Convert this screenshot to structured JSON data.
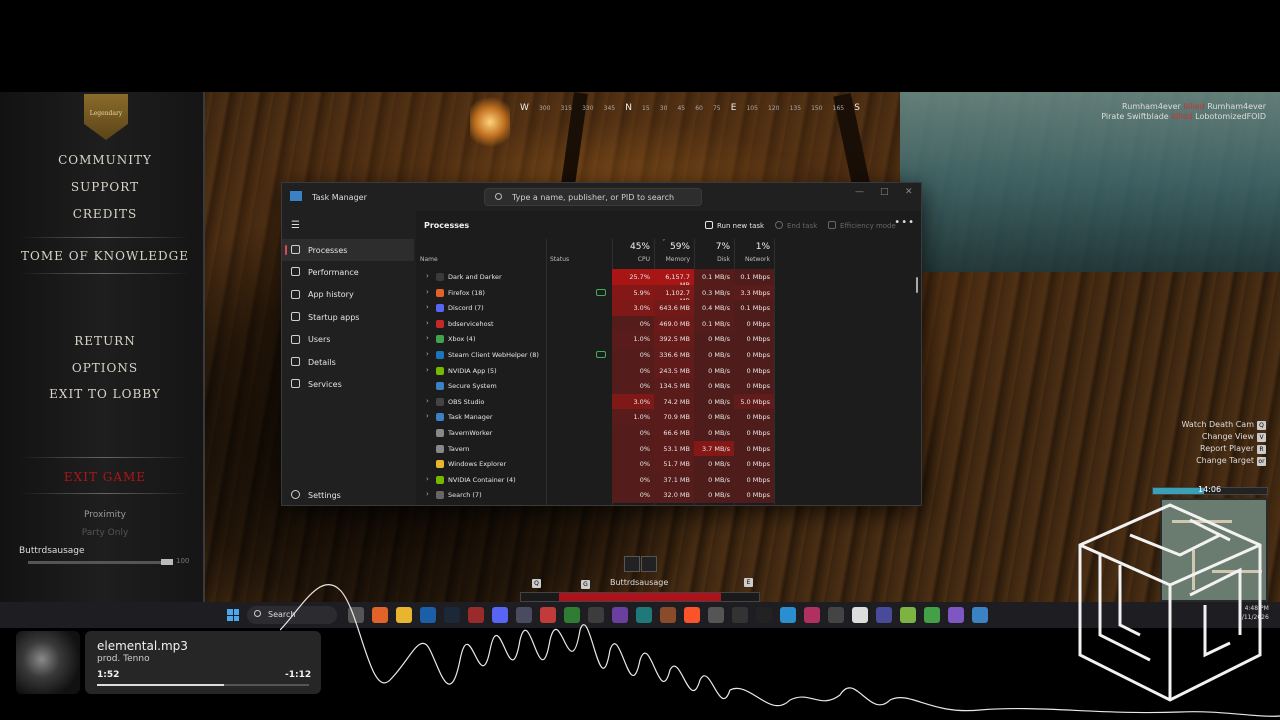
{
  "game": {
    "crest_text": "Legendary",
    "menu": {
      "community": "COMMUNITY",
      "support": "SUPPORT",
      "credits": "CREDITS",
      "tome": "TOME OF KNOWLEDGE",
      "return": "RETURN",
      "options": "OPTIONS",
      "exit_lobby": "EXIT TO LOBBY",
      "exit_game": "EXIT GAME",
      "proximity": "Proximity",
      "party_only": "Party Only"
    },
    "player_name": "Buttrdsausage",
    "volume_value": "100",
    "volume_level": 0.95,
    "compass": [
      "W",
      "300",
      "315",
      "330",
      "345",
      "N",
      "15",
      "30",
      "45",
      "60",
      "75",
      "E",
      "105",
      "120",
      "135",
      "150",
      "165",
      "S"
    ],
    "kill_feed": [
      {
        "killer": "Rumham4ever",
        "verb": "killed",
        "victim": "Rumham4ever"
      },
      {
        "killer": "Pirate Swiftblade",
        "verb": "killed",
        "victim": "LobotomizedFOID"
      }
    ],
    "prompts": [
      {
        "label": "Watch Death Cam",
        "key": "Q"
      },
      {
        "label": "Change View",
        "key": "V"
      },
      {
        "label": "Report Player",
        "key": "R"
      },
      {
        "label": "Change Target",
        "key": "or"
      }
    ],
    "timer": "14:06",
    "hud_name": "Buttrdsausage",
    "hud_keys": [
      "Q",
      "G",
      "E"
    ]
  },
  "task_manager": {
    "title": "Task Manager",
    "search_placeholder": "Type a name, publisher, or PID to search",
    "nav": [
      {
        "label": "Processes",
        "icon": "processes-icon",
        "active": true
      },
      {
        "label": "Performance",
        "icon": "performance-icon"
      },
      {
        "label": "App history",
        "icon": "app-history-icon"
      },
      {
        "label": "Startup apps",
        "icon": "startup-apps-icon"
      },
      {
        "label": "Users",
        "icon": "users-icon"
      },
      {
        "label": "Details",
        "icon": "details-icon"
      },
      {
        "label": "Services",
        "icon": "services-icon"
      }
    ],
    "settings_label": "Settings",
    "page_title": "Processes",
    "toolbar": {
      "run_new_task": "Run new task",
      "end_task": "End task",
      "efficiency_mode": "Efficiency mode"
    },
    "columns": {
      "name": "Name",
      "status": "Status",
      "cpu_pct": "45%",
      "cpu": "CPU",
      "mem_pct": "59%",
      "mem": "Memory",
      "disk_pct": "7%",
      "disk": "Disk",
      "net_pct": "1%",
      "net": "Network"
    },
    "processes": [
      {
        "name": "Dark and Darker",
        "expand": true,
        "icon_color": "#3a3a3a",
        "cpu": "25.7%",
        "mem": "6,157.7 MB",
        "disk": "0.1 MB/s",
        "net": "0.1 Mbps",
        "cpu_heat": 0.9,
        "mem_heat": 0.9,
        "disk_heat": 0.2,
        "net_heat": 0.15,
        "eff": false
      },
      {
        "name": "Firefox (18)",
        "expand": true,
        "icon_color": "#e2632a",
        "cpu": "5.9%",
        "mem": "1,102.7 MB",
        "disk": "0.3 MB/s",
        "net": "3.3 Mbps",
        "cpu_heat": 0.6,
        "mem_heat": 0.55,
        "disk_heat": 0.2,
        "net_heat": 0.25,
        "eff": true
      },
      {
        "name": "Discord (7)",
        "expand": true,
        "icon_color": "#5865f2",
        "cpu": "3.0%",
        "mem": "643.6 MB",
        "disk": "0.4 MB/s",
        "net": "0.1 Mbps",
        "cpu_heat": 0.55,
        "mem_heat": 0.45,
        "disk_heat": 0.2,
        "net_heat": 0.15,
        "eff": false
      },
      {
        "name": "bdservicehost",
        "expand": true,
        "icon_color": "#c62828",
        "cpu": "0%",
        "mem": "469.0 MB",
        "disk": "0.1 MB/s",
        "net": "0 Mbps",
        "cpu_heat": 0.2,
        "mem_heat": 0.4,
        "disk_heat": 0.2,
        "net_heat": 0.15,
        "eff": false
      },
      {
        "name": "Xbox (4)",
        "expand": true,
        "icon_color": "#3fa34d",
        "cpu": "1.0%",
        "mem": "392.5 MB",
        "disk": "0 MB/s",
        "net": "0 Mbps",
        "cpu_heat": 0.25,
        "mem_heat": 0.35,
        "disk_heat": 0.15,
        "net_heat": 0.15,
        "eff": false
      },
      {
        "name": "Steam Client WebHelper (8)",
        "expand": true,
        "icon_color": "#1b75bb",
        "cpu": "0%",
        "mem": "336.6 MB",
        "disk": "0 MB/s",
        "net": "0 Mbps",
        "cpu_heat": 0.2,
        "mem_heat": 0.3,
        "disk_heat": 0.15,
        "net_heat": 0.15,
        "eff": true
      },
      {
        "name": "NVIDIA App (5)",
        "expand": true,
        "icon_color": "#76b900",
        "cpu": "0%",
        "mem": "243.5 MB",
        "disk": "0 MB/s",
        "net": "0 Mbps",
        "cpu_heat": 0.2,
        "mem_heat": 0.3,
        "disk_heat": 0.15,
        "net_heat": 0.15,
        "eff": false
      },
      {
        "name": "Secure System",
        "expand": false,
        "icon_color": "#3b82c4",
        "cpu": "0%",
        "mem": "134.5 MB",
        "disk": "0 MB/s",
        "net": "0 Mbps",
        "cpu_heat": 0.2,
        "mem_heat": 0.25,
        "disk_heat": 0.15,
        "net_heat": 0.15,
        "eff": false
      },
      {
        "name": "OBS Studio",
        "expand": true,
        "icon_color": "#444",
        "cpu": "3.0%",
        "mem": "74.2 MB",
        "disk": "0 MB/s",
        "net": "5.0 Mbps",
        "cpu_heat": 0.55,
        "mem_heat": 0.25,
        "disk_heat": 0.15,
        "net_heat": 0.3,
        "eff": false
      },
      {
        "name": "Task Manager",
        "expand": true,
        "icon_color": "#3b82c4",
        "cpu": "1.0%",
        "mem": "70.9 MB",
        "disk": "0 MB/s",
        "net": "0 Mbps",
        "cpu_heat": 0.25,
        "mem_heat": 0.25,
        "disk_heat": 0.15,
        "net_heat": 0.15,
        "eff": false
      },
      {
        "name": "TavernWorker",
        "expand": false,
        "icon_color": "#888",
        "cpu": "0%",
        "mem": "66.6 MB",
        "disk": "0 MB/s",
        "net": "0 Mbps",
        "cpu_heat": 0.2,
        "mem_heat": 0.25,
        "disk_heat": 0.15,
        "net_heat": 0.15,
        "eff": false
      },
      {
        "name": "Tavern",
        "expand": false,
        "icon_color": "#888",
        "cpu": "0%",
        "mem": "53.1 MB",
        "disk": "3.7 MB/s",
        "net": "0 Mbps",
        "cpu_heat": 0.2,
        "mem_heat": 0.25,
        "disk_heat": 0.6,
        "net_heat": 0.15,
        "eff": false
      },
      {
        "name": "Windows Explorer",
        "expand": false,
        "icon_color": "#e8b52f",
        "cpu": "0%",
        "mem": "51.7 MB",
        "disk": "0 MB/s",
        "net": "0 Mbps",
        "cpu_heat": 0.2,
        "mem_heat": 0.25,
        "disk_heat": 0.15,
        "net_heat": 0.15,
        "eff": false
      },
      {
        "name": "NVIDIA Container (4)",
        "expand": true,
        "icon_color": "#76b900",
        "cpu": "0%",
        "mem": "37.1 MB",
        "disk": "0 MB/s",
        "net": "0 Mbps",
        "cpu_heat": 0.2,
        "mem_heat": 0.2,
        "disk_heat": 0.15,
        "net_heat": 0.15,
        "eff": false
      },
      {
        "name": "Search (7)",
        "expand": true,
        "icon_color": "#666",
        "cpu": "0%",
        "mem": "32.0 MB",
        "disk": "0 MB/s",
        "net": "0 Mbps",
        "cpu_heat": 0.2,
        "mem_heat": 0.2,
        "disk_heat": 0.15,
        "net_heat": 0.15,
        "eff": false
      }
    ]
  },
  "taskbar": {
    "search_label": "Search",
    "time": "4:48 PM",
    "date": "1/11/2026",
    "icons": [
      {
        "name": "taskview-icon",
        "color": "#555"
      },
      {
        "name": "firefox-icon",
        "color": "#e2632a"
      },
      {
        "name": "explorer-icon",
        "color": "#e8b52f"
      },
      {
        "name": "app-icon-blue",
        "color": "#1b5fa8"
      },
      {
        "name": "steam-icon",
        "color": "#1b2838"
      },
      {
        "name": "app-icon-red",
        "color": "#9b2b2b"
      },
      {
        "name": "discord-icon",
        "color": "#5865f2"
      },
      {
        "name": "calculator-icon",
        "color": "#4a4a60"
      },
      {
        "name": "app-icon-round",
        "color": "#c23b3b"
      },
      {
        "name": "app-icon-green",
        "color": "#2e7d32"
      },
      {
        "name": "app-icon-gray",
        "color": "#3c3c3c"
      },
      {
        "name": "app-icon-purple",
        "color": "#6a3fa0"
      },
      {
        "name": "app-icon-teal",
        "color": "#1e7a7a"
      },
      {
        "name": "app-icon-pen",
        "color": "#8a4b2b"
      },
      {
        "name": "brave-icon",
        "color": "#fb542b"
      },
      {
        "name": "obs-icon",
        "color": "#555"
      },
      {
        "name": "app-icon-dark",
        "color": "#333"
      },
      {
        "name": "app-icon-x",
        "color": "#222"
      },
      {
        "name": "app-icon-sky",
        "color": "#2a8fd0"
      },
      {
        "name": "app-icon-mail",
        "color": "#b03060"
      },
      {
        "name": "app-icon-square",
        "color": "#444"
      },
      {
        "name": "file-icon",
        "color": "#ddd"
      },
      {
        "name": "app-icon-a",
        "color": "#4a4a9a"
      },
      {
        "name": "app-icon-lime",
        "color": "#7cb342"
      },
      {
        "name": "app-icon-leaf",
        "color": "#43a047"
      },
      {
        "name": "app-icon-msg",
        "color": "#7e57c2"
      },
      {
        "name": "taskmanager-icon",
        "color": "#3b82c4"
      }
    ]
  },
  "now_playing": {
    "title": "elemental.mp3",
    "artist": "prod. Tenno",
    "elapsed": "1:52",
    "remaining": "-1:12",
    "progress": 0.6
  }
}
